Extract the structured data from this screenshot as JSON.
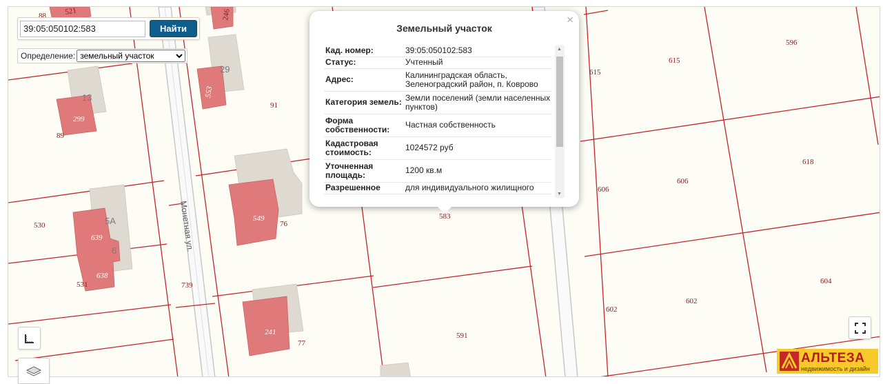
{
  "search": {
    "value": "39:05:050102:583",
    "button_label": "Найти"
  },
  "definition": {
    "label": "Определение:",
    "selected": "земельный участок"
  },
  "popup": {
    "title": "Земельный участок",
    "close_symbol": "×",
    "rows": [
      {
        "key": "Кад. номер:",
        "value": "39:05:050102:583"
      },
      {
        "key": "Статус:",
        "value": "Учтенный"
      },
      {
        "key": "Адрес:",
        "value": "Калининградская область, Зеленоградский район, п. Коврово"
      },
      {
        "key": "Категория земель:",
        "value": "Земли поселений (земли населенных пунктов)"
      },
      {
        "key": "Форма собственности:",
        "value": "Частная собственность"
      },
      {
        "key": "Кадастровая стоимость:",
        "value": "1024572 руб"
      },
      {
        "key": "Уточненная площадь:",
        "value": "1200 кв.м"
      },
      {
        "key": "Разрешенное",
        "value": "для индивидуального жилищного"
      }
    ]
  },
  "map": {
    "street_name": "Монетная ул.",
    "plot_numbers": [
      "88",
      "521",
      "246",
      "91",
      "615",
      "615",
      "596",
      "89",
      "530",
      "531",
      "739",
      "76",
      "77",
      "583",
      "591",
      "606",
      "606",
      "618",
      "602",
      "602",
      "604"
    ],
    "building_numbers": [
      "299",
      "553",
      "549",
      "639",
      "638",
      "241"
    ],
    "house_numbers": [
      "29",
      "13",
      "5А",
      "6"
    ],
    "colors": {
      "plot_border": "#c8232c",
      "building": "#e07a7a",
      "building_shadow": "#dedad2",
      "road": "#c8c8c8"
    }
  },
  "controls": {
    "ruler_icon": "ruler-icon",
    "fullscreen_icon": "fullscreen-icon",
    "layers_icon": "layers-icon"
  },
  "brand": {
    "name": "АЛЬТЕЗА",
    "tagline": "недвижимость и дизайн"
  }
}
